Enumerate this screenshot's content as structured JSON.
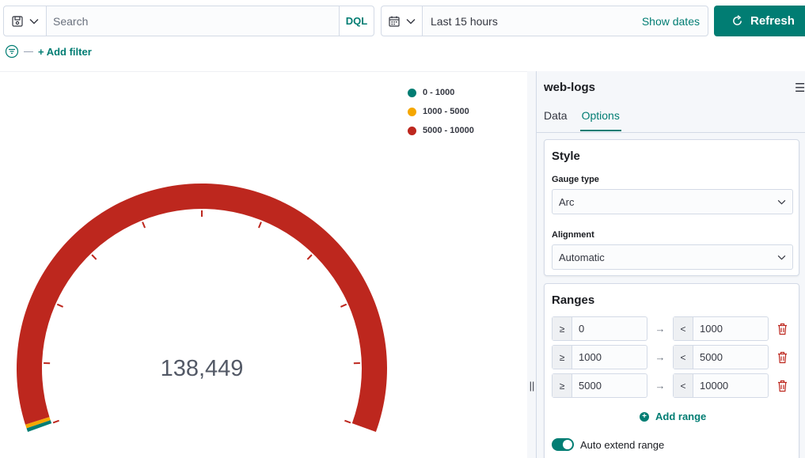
{
  "query_bar": {
    "search_placeholder": "Search",
    "language_label": "DQL",
    "date_range": "Last 15 hours",
    "show_dates_label": "Show dates",
    "refresh_label": "Refresh",
    "add_filter_label": "+ Add filter"
  },
  "gauge": {
    "value": 138449,
    "value_label": "138,449",
    "color_max_range": "#bd271e",
    "legend": [
      {
        "label": "0 - 1000",
        "color": "#017d73"
      },
      {
        "label": "1000 - 5000",
        "color": "#f5a700"
      },
      {
        "label": "5000 - 10000",
        "color": "#bd271e"
      }
    ]
  },
  "sidebar": {
    "index_pattern": "web-logs",
    "tabs": [
      {
        "label": "Data",
        "active": false
      },
      {
        "label": "Options",
        "active": true
      }
    ],
    "style": {
      "heading": "Style",
      "gauge_type_label": "Gauge type",
      "gauge_type_value": "Arc",
      "alignment_label": "Alignment",
      "alignment_value": "Automatic"
    },
    "ranges": {
      "heading": "Ranges",
      "rows": [
        {
          "from_prefix": "≥",
          "from": "0",
          "to_prefix": "<",
          "to": "1000"
        },
        {
          "from_prefix": "≥",
          "from": "1000",
          "to_prefix": "<",
          "to": "5000"
        },
        {
          "from_prefix": "≥",
          "from": "5000",
          "to_prefix": "<",
          "to": "10000"
        }
      ],
      "add_range_label": "Add range",
      "auto_extend_label": "Auto extend range",
      "auto_extend_enabled": true
    }
  },
  "colors": {
    "accent": "#017d73",
    "danger": "#bd271e",
    "warning": "#f5a700"
  },
  "icons": {
    "saved_query": "save-disk-icon",
    "calendar": "calendar-icon",
    "refresh": "refresh-icon",
    "filter": "filter-icon",
    "delete": "trash-icon",
    "add": "plus-circle-icon",
    "menu": "options-menu-icon"
  }
}
